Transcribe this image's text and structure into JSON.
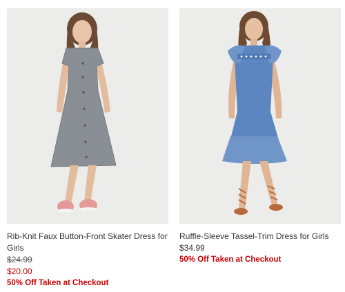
{
  "colors": {
    "sale_red": "#cc0000",
    "text": "#333333",
    "photo_bg": "#ececea"
  },
  "products": [
    {
      "title": "Rib-Knit Faux Button-Front Skater Dress for Girls",
      "original_price": "$24.99",
      "sale_price": "$20.00",
      "promo": "50% Off Taken at Checkout",
      "image_subject": "girl in gray rib-knit button-front dress with pink sneakers"
    },
    {
      "title": "Ruffle-Sleeve Tassel-Trim Dress for Girls",
      "price": "$34.99",
      "promo": "50% Off Taken at Checkout",
      "image_subject": "girl in blue chambray ruffle-sleeve dress with lace-up sandals"
    }
  ]
}
